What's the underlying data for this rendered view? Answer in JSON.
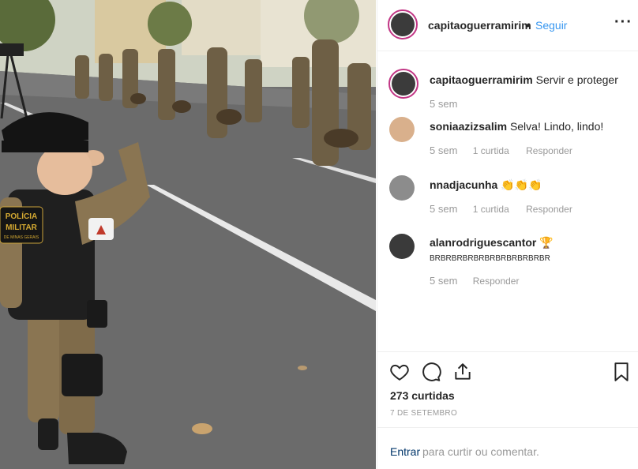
{
  "post": {
    "username": "capitaoguerramirim",
    "separator": "•",
    "follow_label": "Seguir",
    "more_icon": "more-horizontal-icon"
  },
  "caption": {
    "username": "capitaoguerramirim",
    "text": "Servir e proteger",
    "time": "5 sem"
  },
  "comments": [
    {
      "username": "soniaazizsalim",
      "text": "Selva! Lindo, lindo!",
      "time": "5 sem",
      "likes": "1 curtida",
      "reply": "Responder"
    },
    {
      "username": "nnadjacunha",
      "text": "👏👏👏",
      "time": "5 sem",
      "likes": "1 curtida",
      "reply": "Responder"
    },
    {
      "username": "alanrodriguescantor",
      "trophy": "🏆",
      "text": "BRBRBRBRBRBRBRBRBRBRBR",
      "time": "5 sem",
      "reply": "Responder"
    }
  ],
  "actions": {
    "icons": [
      "heart-icon",
      "comment-icon",
      "share-icon",
      "bookmark-icon"
    ],
    "likes_count": "273 curtidas",
    "date": "7 DE SETEMBRO"
  },
  "add_comment": {
    "login_link": "Entrar",
    "rest": "para curtir ou comentar."
  },
  "photo": {
    "patch_text_line1": "POLÍCIA",
    "patch_text_line2": "MILITAR",
    "patch_text_line3": "DE MINAS GERAIS"
  },
  "colors": {
    "link_blue": "#3897f0",
    "text": "#262626",
    "muted": "#999999",
    "story_ring": "#c13584"
  }
}
